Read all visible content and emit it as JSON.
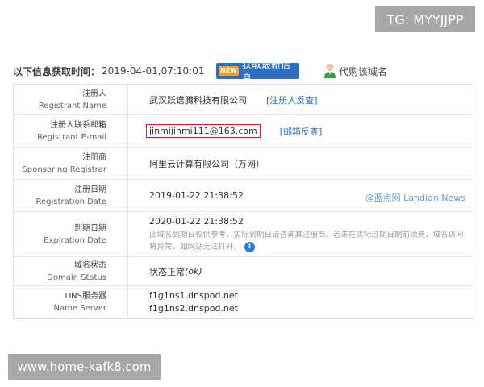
{
  "overlay": {
    "tg": "TG: MYYJJPP",
    "site": "www.home-kafk8.com"
  },
  "header": {
    "label": "以下信息获取时间：",
    "time": "2019-04-01,07:10:01",
    "refresh_tag": "NEW",
    "refresh_label": "获取最新信息",
    "buy_label": "代购该域名"
  },
  "rows": [
    {
      "cn": "注册人",
      "en": "Registrant Name",
      "value": "武汉跃谱腾科技有限公司",
      "link": "[注册人反查]"
    },
    {
      "cn": "注册人联系邮箱",
      "en": "Registrant E-mail",
      "value": "jinmijinmi111@163.com",
      "link": "[邮箱反查]"
    },
    {
      "cn": "注册商",
      "en": "Sponsoring Registrar",
      "value": "阿里云计算有限公司（万网）"
    },
    {
      "cn": "注册日期",
      "en": "Registration Date",
      "value": "2019-01-22 21:38:52",
      "watermark": "@蓝点网 Landian.News"
    },
    {
      "cn": "到期日期",
      "en": "Expiration Date",
      "value": "2020-01-22 21:38:52",
      "note": "此域名到期日仅供参考，实际到期日请咨询其注册商。若未在实际过期日期前续费，域名访问将异常，如网站无法打开。"
    },
    {
      "cn": "域名状态",
      "en": "Domain Status",
      "value": "状态正常",
      "value_em": "(ok)"
    },
    {
      "cn": "DNS服务器",
      "en": "Name Server",
      "ns1": "f1g1ns1.dnspod.net",
      "ns2": "f1g1ns2.dnspod.net"
    }
  ],
  "colors": {
    "accent": "#2d6fc4",
    "highlight_border": "#d9202a"
  }
}
